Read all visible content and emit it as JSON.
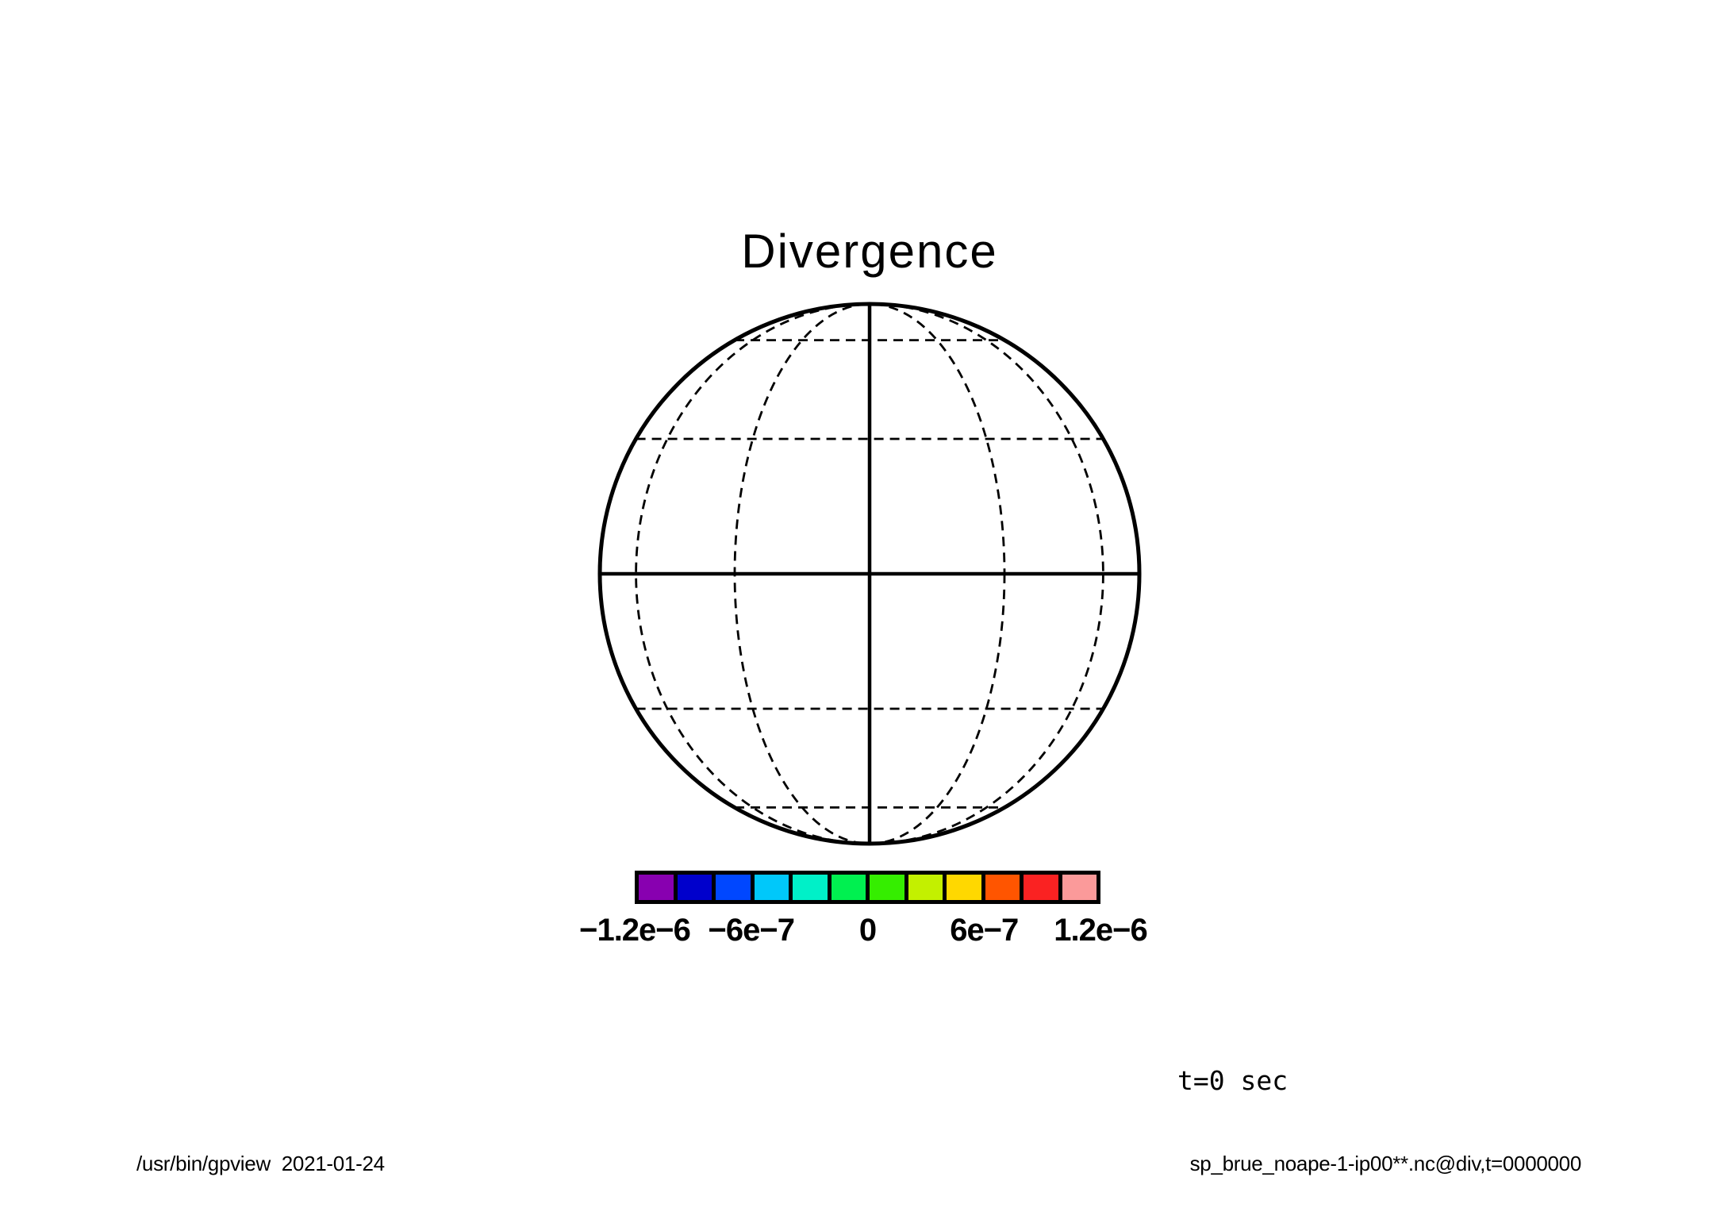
{
  "page": {
    "background": "#ffffff",
    "foreground": "#000000"
  },
  "title": "Divergence",
  "time_label": "t=0 sec",
  "footer": {
    "left": "/usr/bin/gpview  2021-01-24",
    "right": "sp_brue_noape-1-ip00**.nc@div,t=0000000"
  },
  "globe": {
    "line_color": "#000000",
    "solid_elements": [
      "limb",
      "equator",
      "central-meridian"
    ],
    "dashed_parallels_deg": [
      30,
      60
    ],
    "dashed_meridians_deg": [
      30,
      60
    ]
  },
  "colorbar": {
    "colors": [
      "#8800b0",
      "#0000cc",
      "#0047ff",
      "#00c8fa",
      "#00f0c8",
      "#00f050",
      "#35ee00",
      "#c3f000",
      "#ffd800",
      "#ff5500",
      "#fa2222",
      "#fb9a9a"
    ],
    "ticks": [
      {
        "label": "−1.2e−6",
        "pos": 0
      },
      {
        "label": "−6e−7",
        "pos": 0.25
      },
      {
        "label": "0",
        "pos": 0.5
      },
      {
        "label": "6e−7",
        "pos": 0.75
      },
      {
        "label": "1.2e−6",
        "pos": 1
      }
    ]
  },
  "chart_data": {
    "type": "heatmap",
    "title": "Divergence",
    "projection": "orthographic globe, equatorial view, graticule every 30 degrees",
    "graticule": {
      "solid": [
        "limb",
        "equator",
        "central meridian"
      ],
      "dashed_parallels_deg": [
        -60,
        -30,
        30,
        60
      ],
      "dashed_meridians_deg": [
        -60,
        -30,
        30,
        60
      ]
    },
    "field_note": "no contour/tone fill visible inside the globe (field uniform at t=0)",
    "colorbar": {
      "min": -1.2e-06,
      "max": 1.2e-06,
      "interval": 2e-07,
      "n_cells": 12,
      "tick_values": [
        -1.2e-06,
        -6e-07,
        0,
        6e-07,
        1.2e-06
      ],
      "tick_labels": [
        "−1.2e−6",
        "−6e−7",
        "0",
        "6e−7",
        "1.2e−6"
      ],
      "colors": [
        "#8800b0",
        "#0000cc",
        "#0047ff",
        "#00c8fa",
        "#00f0c8",
        "#00f050",
        "#35ee00",
        "#c3f000",
        "#ffd800",
        "#ff5500",
        "#fa2222",
        "#fb9a9a"
      ],
      "legend_position": "bottom"
    },
    "time": "t=0 sec",
    "annotations": [
      "/usr/bin/gpview  2021-01-24",
      "sp_brue_noape-1-ip00**.nc@div,t=0000000"
    ]
  }
}
